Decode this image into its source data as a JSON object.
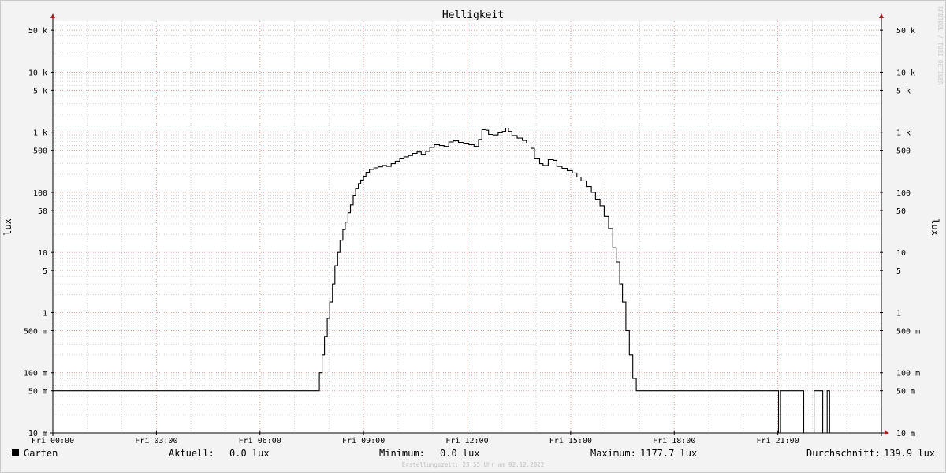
{
  "chart_data": {
    "type": "line",
    "title": "Helligkeit",
    "ylabel": "lux",
    "ylabel_right": "lux",
    "watermark": "RRDTOOL / TOBI OETIKER",
    "scale": "log",
    "ylim": [
      0.01,
      70000
    ],
    "xlim": [
      0,
      24
    ],
    "grid": true,
    "y_ticks": [
      {
        "value": 50000,
        "label": "50 k"
      },
      {
        "value": 10000,
        "label": "10 k"
      },
      {
        "value": 5000,
        "label": "5 k"
      },
      {
        "value": 1000,
        "label": "1 k"
      },
      {
        "value": 500,
        "label": "500"
      },
      {
        "value": 100,
        "label": "100"
      },
      {
        "value": 50,
        "label": "50"
      },
      {
        "value": 10,
        "label": "10"
      },
      {
        "value": 5,
        "label": "5"
      },
      {
        "value": 1,
        "label": "1"
      },
      {
        "value": 0.5,
        "label": "500 m"
      },
      {
        "value": 0.1,
        "label": "100 m"
      },
      {
        "value": 0.05,
        "label": "50 m"
      },
      {
        "value": 0.01,
        "label": "10 m"
      }
    ],
    "x_ticks": [
      {
        "value": 0,
        "label": "Fri 00:00"
      },
      {
        "value": 3,
        "label": "Fri 03:00"
      },
      {
        "value": 6,
        "label": "Fri 06:00"
      },
      {
        "value": 9,
        "label": "Fri 09:00"
      },
      {
        "value": 12,
        "label": "Fri 12:00"
      },
      {
        "value": 15,
        "label": "Fri 15:00"
      },
      {
        "value": 18,
        "label": "Fri 18:00"
      },
      {
        "value": 21,
        "label": "Fri 21:00"
      }
    ],
    "series": [
      {
        "name": "Garten",
        "color": "#000000",
        "points": [
          [
            0,
            0.05
          ],
          [
            7.67,
            0.05
          ],
          [
            7.72,
            0.1
          ],
          [
            7.8,
            0.2
          ],
          [
            7.87,
            0.4
          ],
          [
            7.95,
            0.8
          ],
          [
            8.02,
            1.5
          ],
          [
            8.1,
            3
          ],
          [
            8.17,
            6
          ],
          [
            8.25,
            10
          ],
          [
            8.32,
            16
          ],
          [
            8.4,
            24
          ],
          [
            8.47,
            32
          ],
          [
            8.55,
            46
          ],
          [
            8.62,
            62
          ],
          [
            8.7,
            90
          ],
          [
            8.77,
            115
          ],
          [
            8.85,
            140
          ],
          [
            8.92,
            160
          ],
          [
            9.0,
            185
          ],
          [
            9.07,
            215
          ],
          [
            9.17,
            240
          ],
          [
            9.3,
            255
          ],
          [
            9.42,
            265
          ],
          [
            9.55,
            280
          ],
          [
            9.67,
            270
          ],
          [
            9.8,
            300
          ],
          [
            9.92,
            330
          ],
          [
            10.05,
            360
          ],
          [
            10.17,
            390
          ],
          [
            10.3,
            410
          ],
          [
            10.42,
            445
          ],
          [
            10.55,
            470
          ],
          [
            10.67,
            430
          ],
          [
            10.8,
            480
          ],
          [
            10.92,
            560
          ],
          [
            11.05,
            620
          ],
          [
            11.2,
            600
          ],
          [
            11.33,
            580
          ],
          [
            11.47,
            690
          ],
          [
            11.6,
            720
          ],
          [
            11.75,
            680
          ],
          [
            11.9,
            640
          ],
          [
            12.05,
            620
          ],
          [
            12.2,
            580
          ],
          [
            12.33,
            760
          ],
          [
            12.43,
            1100
          ],
          [
            12.55,
            1080
          ],
          [
            12.62,
            920
          ],
          [
            12.75,
            900
          ],
          [
            12.9,
            980
          ],
          [
            13.02,
            1030
          ],
          [
            13.12,
            1170
          ],
          [
            13.2,
            1030
          ],
          [
            13.3,
            880
          ],
          [
            13.45,
            800
          ],
          [
            13.6,
            730
          ],
          [
            13.72,
            660
          ],
          [
            13.85,
            540
          ],
          [
            13.95,
            360
          ],
          [
            14.1,
            300
          ],
          [
            14.2,
            280
          ],
          [
            14.35,
            350
          ],
          [
            14.5,
            340
          ],
          [
            14.6,
            270
          ],
          [
            14.75,
            250
          ],
          [
            14.9,
            230
          ],
          [
            15.05,
            210
          ],
          [
            15.18,
            180
          ],
          [
            15.3,
            155
          ],
          [
            15.45,
            125
          ],
          [
            15.6,
            100
          ],
          [
            15.72,
            75
          ],
          [
            15.85,
            60
          ],
          [
            15.97,
            40
          ],
          [
            16.1,
            25
          ],
          [
            16.22,
            12
          ],
          [
            16.32,
            7
          ],
          [
            16.42,
            3
          ],
          [
            16.5,
            1.5
          ],
          [
            16.6,
            0.5
          ],
          [
            16.7,
            0.2
          ],
          [
            16.8,
            0.08
          ],
          [
            16.9,
            0.05
          ],
          [
            21.0,
            0.05
          ],
          [
            21.02,
            0.01
          ],
          [
            21.08,
            0.05
          ],
          [
            21.75,
            0.01
          ],
          [
            22.05,
            0.05
          ],
          [
            22.3,
            0.01
          ],
          [
            22.43,
            0.05
          ],
          [
            22.5,
            0.01
          ],
          [
            24.0,
            0.01
          ]
        ]
      }
    ]
  },
  "legend": {
    "series_name": "Garten",
    "series_color": "#000000",
    "current_label": "Aktuell:",
    "current_value": "0.0 lux",
    "min_label": "Minimum:",
    "min_value": "0.0 lux",
    "max_label": "Maximum:",
    "max_value": "1177.7 lux",
    "avg_label": "Durchschnitt:",
    "avg_value": "139.9 lux"
  },
  "footer": {
    "timestamp": "Erstellungszeit: 23:55 Uhr am 02.12.2022"
  }
}
